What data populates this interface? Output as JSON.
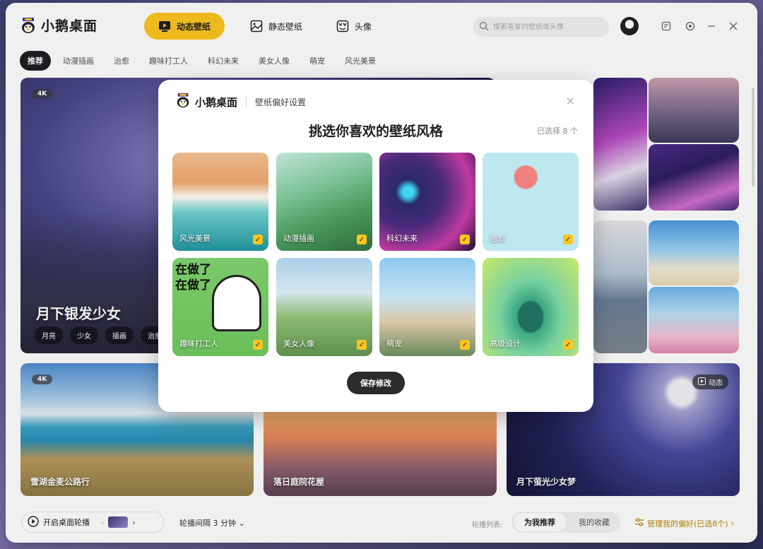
{
  "app": {
    "name": "小鹅桌面"
  },
  "nav": {
    "tabs": [
      {
        "label": "动态壁纸"
      },
      {
        "label": "静态壁纸"
      },
      {
        "label": "头像"
      }
    ]
  },
  "search": {
    "placeholder": "搜索喜爱的壁纸或头像"
  },
  "categories": [
    "推荐",
    "动漫插画",
    "治愈",
    "趣味打工人",
    "科幻未来",
    "美女人像",
    "萌宠",
    "风光美景"
  ],
  "featured": {
    "badge": "4K",
    "title": "月下银发少女",
    "tags": [
      "月亮",
      "少女",
      "插画",
      "治愈"
    ]
  },
  "row2": [
    {
      "badge": "4K",
      "title": "雪湖金麦公路行"
    },
    {
      "title": "落日庭院花屋"
    },
    {
      "badge": "动态",
      "title": "月下萤光少女梦"
    }
  ],
  "bottom": {
    "carousel_label": "开启桌面轮播",
    "interval_label": "轮播间隔 3 分钟",
    "list_label": "轮播列表:",
    "seg_recommend": "为我推荐",
    "seg_favorites": "我的收藏",
    "manage_label": "管理我的偏好(已选8个)"
  },
  "modal": {
    "logo_text": "小鹅桌面",
    "subtitle": "壁纸偏好设置",
    "title": "挑选你喜欢的壁纸风格",
    "count": "已选择 8 个",
    "tiles": [
      {
        "label": "风光美景"
      },
      {
        "label": "动漫插画"
      },
      {
        "label": "科幻未来"
      },
      {
        "label": "治愈"
      },
      {
        "label": "趣味打工人"
      },
      {
        "label": "美女人像"
      },
      {
        "label": "萌宠"
      },
      {
        "label": "高级设计"
      }
    ],
    "meme_text_1": "在做了",
    "meme_text_2": "在做了",
    "save_label": "保存修改"
  },
  "colors": {
    "accent": "#fcc51f",
    "dark": "#1f1f24"
  }
}
